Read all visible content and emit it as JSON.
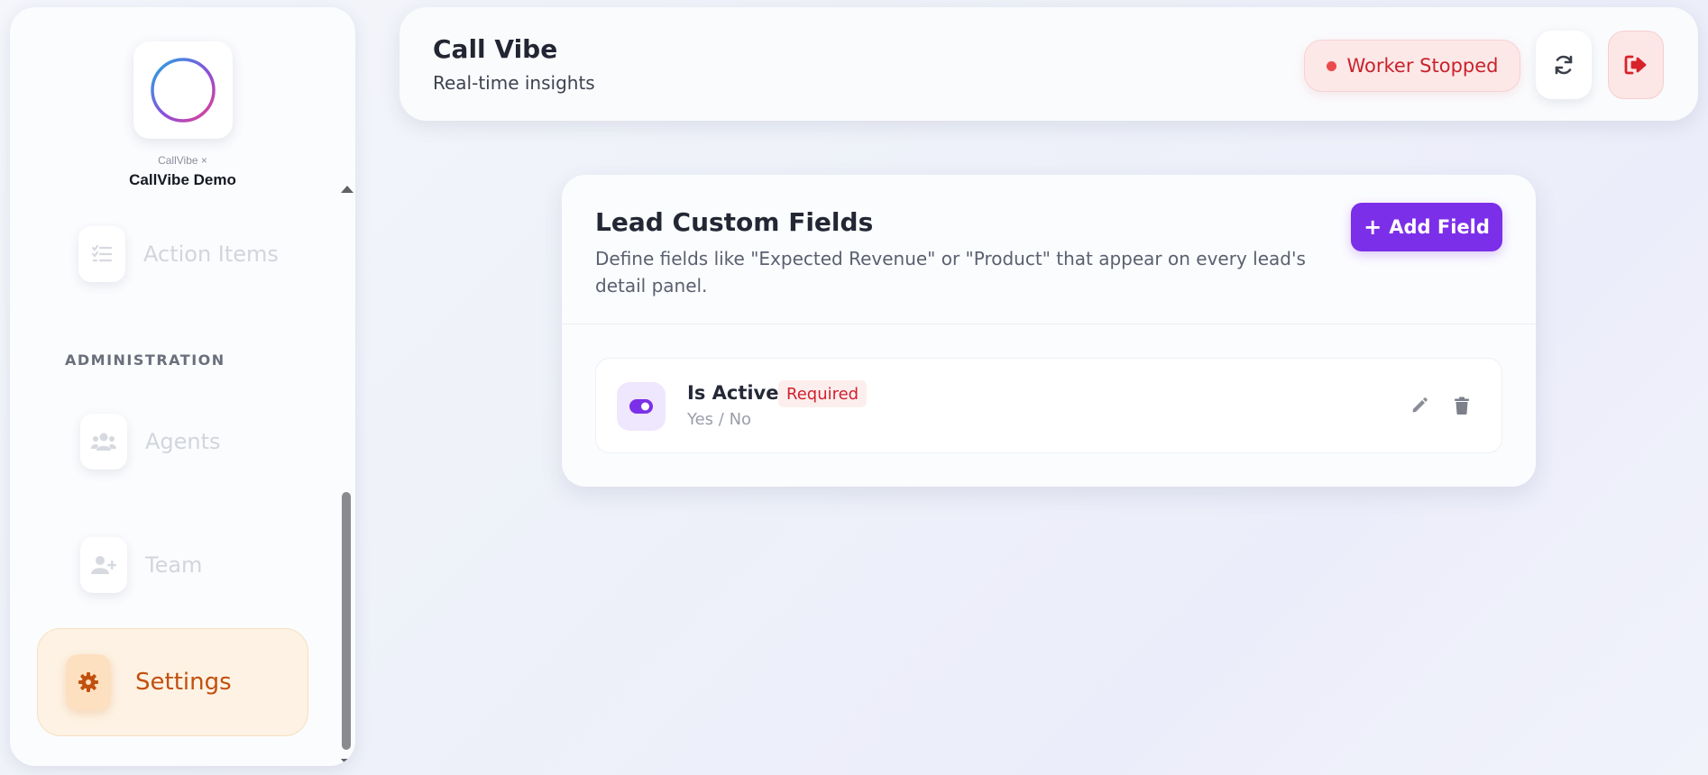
{
  "sidebar": {
    "brand_sub": "CallVibe ×",
    "brand_name": "CallVibe Demo",
    "section_label": "ADMINISTRATION",
    "items": [
      {
        "label": "Action Items",
        "icon": "checklist-icon",
        "active": false
      },
      {
        "label": "Agents",
        "icon": "users-icon",
        "active": false
      },
      {
        "label": "Team",
        "icon": "user-plus-icon",
        "active": false
      },
      {
        "label": "Settings",
        "icon": "gear-icon",
        "active": true
      }
    ]
  },
  "header": {
    "title": "Call Vibe",
    "subtitle": "Real-time insights",
    "status": "Worker Stopped"
  },
  "card": {
    "title": "Lead Custom Fields",
    "description": "Define fields like \"Expected Revenue\" or \"Product\" that appear on every lead's detail panel.",
    "add_button": "Add Field",
    "add_icon": "+",
    "fields": [
      {
        "name": "Is Active",
        "badge": "Required",
        "type": "Yes / No",
        "icon": "toggle-icon"
      }
    ]
  },
  "colors": {
    "accent": "#7c2fe8",
    "active_nav": "#c1500f",
    "danger": "#c8232b"
  }
}
